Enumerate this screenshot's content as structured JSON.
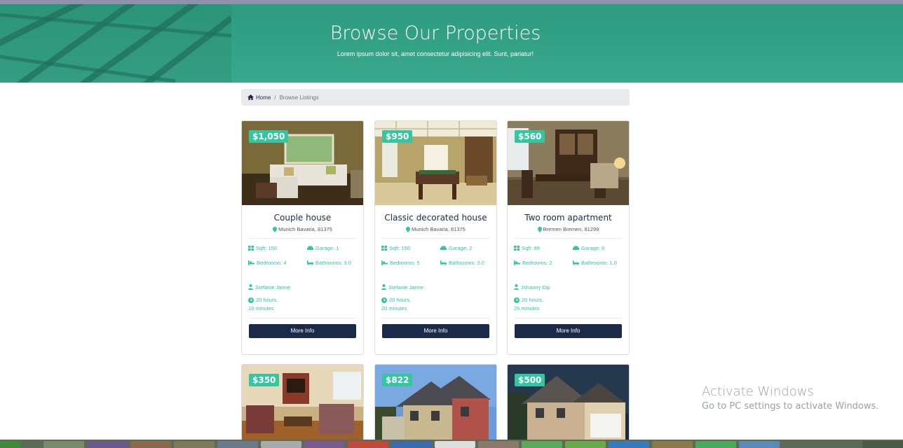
{
  "hero": {
    "title": "Browse Our Properties",
    "subtitle": "Lorem ipsum dolor sit, amet consectetur adipisicing elit. Sunt, pariatur!"
  },
  "breadcrumb": {
    "home": "Home",
    "current": "Browse Listings"
  },
  "colors": {
    "accent": "#35c6a0",
    "navy": "#1b2a4b",
    "hero": "#3aa88b"
  },
  "listings": [
    {
      "price": "$1,050",
      "title": "Couple house",
      "location": "Munich Bavaria, 81375",
      "sqft": "Sqft: 150",
      "garage": "Garage: 1",
      "bedrooms": "Bedrooms: 4",
      "bathrooms": "Bathrooms: 3.0",
      "agent": "Stefanie Janne",
      "time_line1": "20 hours,",
      "time_line2": "19 minutes",
      "button": "More Info"
    },
    {
      "price": "$950",
      "title": "Classic decorated house",
      "location": "Munich Bavaria, 81375",
      "sqft": "Sqft: 150",
      "garage": "Garage: 2",
      "bedrooms": "Bedrooms: 5",
      "bathrooms": "Bathrooms: 3.0",
      "agent": "Stefanie Janne",
      "time_line1": "20 hours,",
      "time_line2": "20 minutes",
      "button": "More Info"
    },
    {
      "price": "$560",
      "title": "Two room apartment",
      "location": "Bremen Bremen, 81299",
      "sqft": "Sqft: 89",
      "garage": "Garage: 0",
      "bedrooms": "Bedrooms: 2",
      "bathrooms": "Bathrooms: 1.0",
      "agent": "Johanny Dip",
      "time_line1": "20 hours,",
      "time_line2": "26 minutes",
      "button": "More Info"
    },
    {
      "price": "$350"
    },
    {
      "price": "$822"
    },
    {
      "price": "$500"
    }
  ],
  "watermark": {
    "line1": "Activate Windows",
    "line2": "Go to PC settings to activate Windows."
  }
}
